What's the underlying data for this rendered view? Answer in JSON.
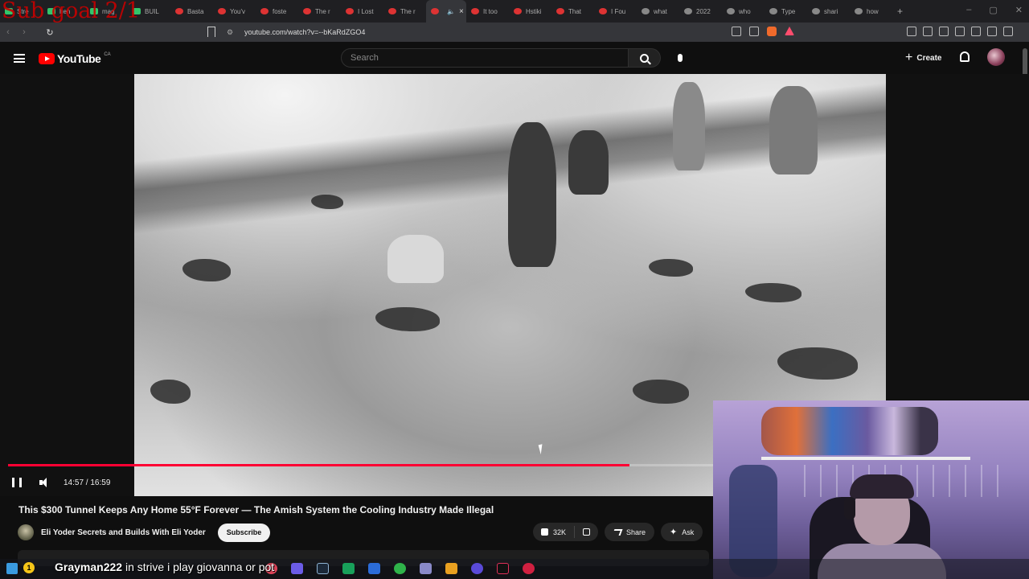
{
  "stream_overlay": {
    "goal_text": "Sub goal 2/1"
  },
  "browser": {
    "tabs": [
      {
        "label": "Stre",
        "fav": "green"
      },
      {
        "label": "hen",
        "fav": "green"
      },
      {
        "label": "mag",
        "fav": "green"
      },
      {
        "label": "BUIL",
        "fav": "green"
      },
      {
        "label": "Basta",
        "fav": "red"
      },
      {
        "label": "You'v",
        "fav": "red"
      },
      {
        "label": "foste",
        "fav": "red"
      },
      {
        "label": "The r",
        "fav": "red"
      },
      {
        "label": "I Lost",
        "fav": "red"
      },
      {
        "label": "The r",
        "fav": "red"
      },
      {
        "label": "",
        "fav": "red",
        "active": true
      },
      {
        "label": "It too",
        "fav": "red"
      },
      {
        "label": "Hstiki",
        "fav": "red"
      },
      {
        "label": "That",
        "fav": "red"
      },
      {
        "label": "I Fou",
        "fav": "red"
      },
      {
        "label": "what",
        "fav": "gray"
      },
      {
        "label": "2022",
        "fav": "gray"
      },
      {
        "label": "who",
        "fav": "gray"
      },
      {
        "label": "Type",
        "fav": "gray"
      },
      {
        "label": "shari",
        "fav": "gray"
      },
      {
        "label": "how",
        "fav": "gray"
      }
    ],
    "url": "youtube.com/watch?v=--bKaRdZGO4"
  },
  "youtube": {
    "logo_text": "YouTube",
    "region": "CA",
    "search_placeholder": "Search",
    "create_label": "Create"
  },
  "player": {
    "time": "14:57 / 16:59",
    "progress": 0.881
  },
  "video": {
    "title": "This $300 Tunnel Keeps Any Home 55°F Forever — The Amish System the Cooling Industry Made Illegal",
    "channel": "Eli Yoder Secrets and Builds With Eli Yoder",
    "subscribe_label": "Subscribe",
    "likes": "32K",
    "share_label": "Share",
    "ask_label": "Ask"
  },
  "chat": {
    "badge": "1",
    "user": "Grayman222",
    "message": "in strive i play giovanna or pot"
  },
  "colors": {
    "accent": "#ff0033",
    "brand": "#ff0000",
    "background": "#0f0f0f"
  }
}
